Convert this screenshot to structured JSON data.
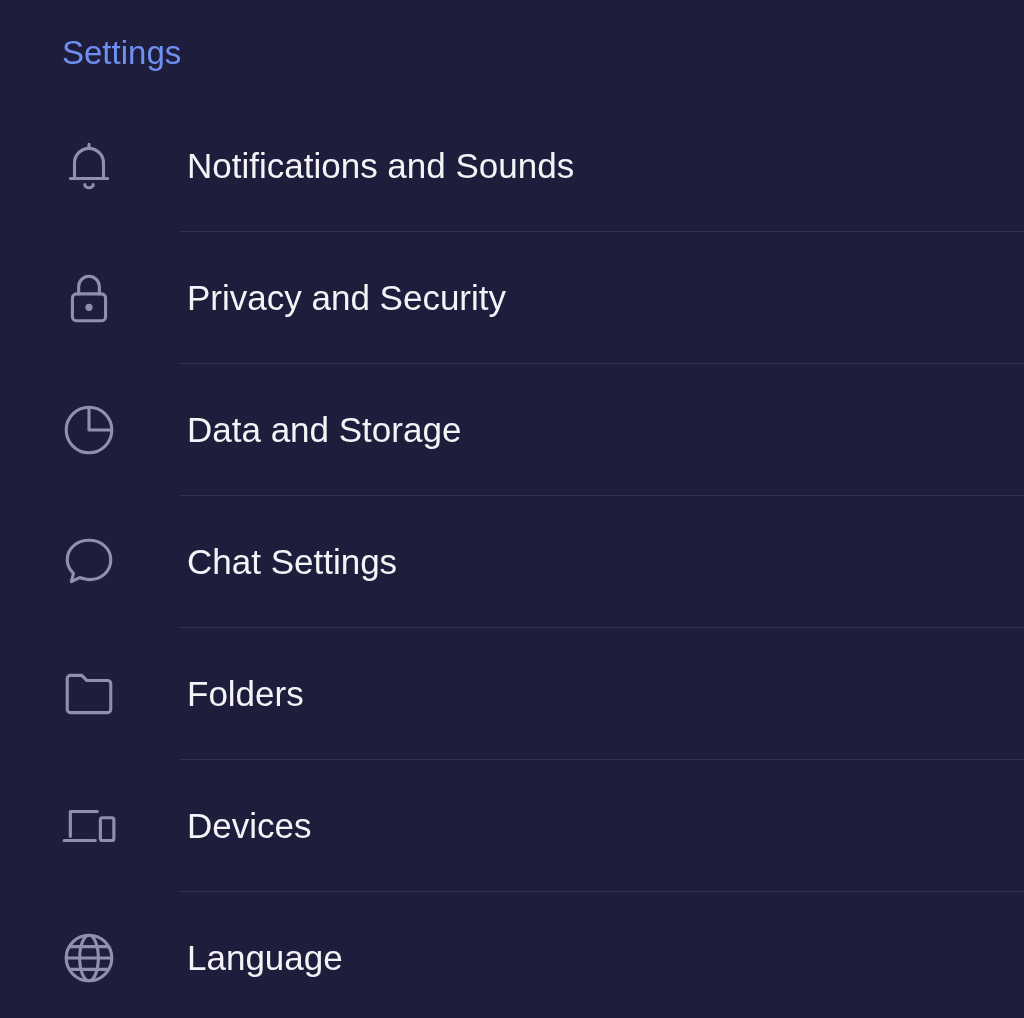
{
  "header": {
    "title": "Settings"
  },
  "items": [
    {
      "label": "Notifications and Sounds"
    },
    {
      "label": "Privacy and Security"
    },
    {
      "label": "Data and Storage"
    },
    {
      "label": "Chat Settings"
    },
    {
      "label": "Folders"
    },
    {
      "label": "Devices"
    },
    {
      "label": "Language"
    }
  ]
}
